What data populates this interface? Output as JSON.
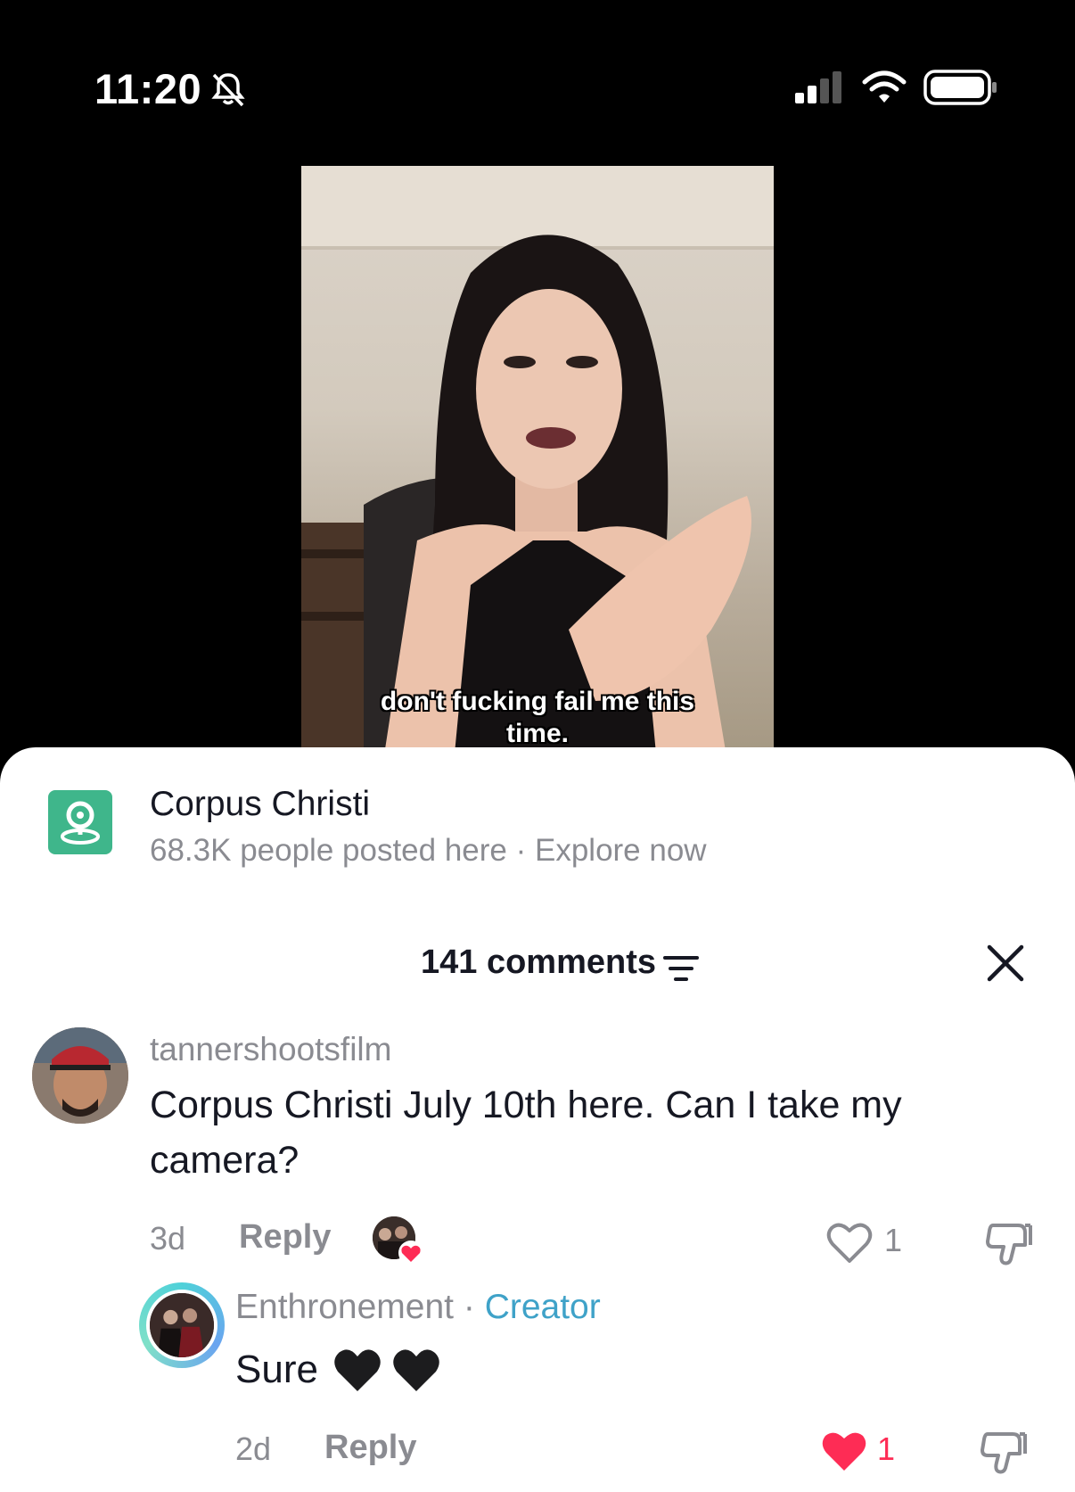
{
  "status_bar": {
    "time": "11:20",
    "icons": [
      "bell-slash-icon",
      "cellular-signal-icon",
      "wifi-icon",
      "battery-icon"
    ]
  },
  "video": {
    "caption_line1": "don't fucking fail me this",
    "caption_line2": "time."
  },
  "location": {
    "icon": "location-pin-icon",
    "title": "Corpus Christi",
    "subtitle": "68.3K people posted here · Explore now"
  },
  "comments": {
    "count_label": "141 comments",
    "sort_icon": "filter-sort-icon",
    "close_icon": "close-icon",
    "items": [
      {
        "username": "tannershootsfilm",
        "text": "Corpus Christi July 10th here. Can I take my camera?",
        "time": "3d",
        "reply_label": "Reply",
        "likes": "1",
        "liked_by_creator": true
      }
    ],
    "replies": [
      {
        "username": "Enthronement",
        "separator": "·",
        "badge": "Creator",
        "text": "Sure",
        "emoji": [
          "black-heart",
          "black-heart"
        ],
        "time": "2d",
        "reply_label": "Reply",
        "likes": "1",
        "liked": true
      }
    ]
  },
  "colors": {
    "accent_green": "#3fb68b",
    "like_red": "#fe2c55",
    "creator_blue": "#3fa2c8",
    "secondary_text": "#8a8b91"
  }
}
